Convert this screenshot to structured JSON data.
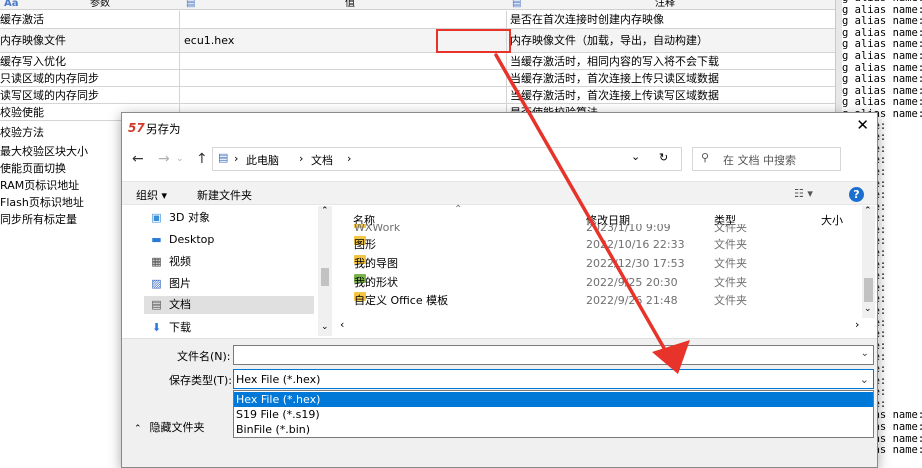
{
  "grid": {
    "headers": [
      "Aa",
      "参数",
      "值",
      "注释"
    ],
    "rows": [
      {
        "param": "缓存激活",
        "value": "",
        "checked": true,
        "note": "是否在首次连接时创建内存映像"
      },
      {
        "param": "内存映像文件",
        "value": "ecu1.hex",
        "checked": false,
        "note": "内存映像文件（加载，导出，自动构建）"
      },
      {
        "param": "缓存写入优化",
        "value": "",
        "checked": true,
        "note": "当缓存激活时，相同内容的写入将不会下载"
      },
      {
        "param": "只读区域的内存同步",
        "value": "",
        "checked": true,
        "note": "当缓存激活时，首次连接上传只读区域数据"
      },
      {
        "param": "读写区域的内存同步",
        "value": "",
        "checked": true,
        "note": "当缓存激活时，首次连接上传读写区域数据"
      },
      {
        "param": "校验使能",
        "value": "",
        "checked": true,
        "note": "是否使能校验算法"
      }
    ],
    "left_labels": [
      "校验方法",
      "最大校验区块大小",
      "使能页面切换",
      "RAM页标识地址",
      "Flash页标识地址",
      "同步所有标定量"
    ]
  },
  "console": {
    "lines": [
      "g alias name:",
      "g alias name:",
      "g alias name:",
      "g alias name:",
      "g alias name:",
      "g alias name:",
      "g alias name:",
      "g alias name:",
      "g alias name:",
      "g alias name:",
      "g alias name:",
      "s name:",
      "s name:",
      "s name:",
      "s name:",
      "s name:",
      "s name:",
      "s name:",
      "s name:",
      "s name:",
      "s name:",
      "s name:",
      "s name:",
      "s name:",
      "s name:",
      "s name:",
      "s name:",
      "s name:",
      "s name:",
      "s name:",
      "s name:",
      "s name:",
      "s name:",
      "s name:",
      "s name:",
      "s name:",
      "g alias name:",
      "g alias name:",
      "g alias name:",
      "g alias name:"
    ]
  },
  "dialog": {
    "icon": "57",
    "title": "另存为",
    "close": "✕",
    "nav": {
      "back": "←",
      "forward": "→",
      "up": "↑"
    },
    "address": {
      "sep": "›",
      "items": [
        "此电脑",
        "文档"
      ],
      "refresh": "↻",
      "dropdown": "⌄"
    },
    "search_placeholder": "在 文档 中搜索",
    "toolbar": {
      "organize": "组织 ▾",
      "new_folder": "新建文件夹",
      "view": "☷ ▾",
      "help": "?"
    },
    "nav_items": [
      {
        "icon": "▣",
        "label": "3D 对象",
        "selected": false
      },
      {
        "icon": "▬",
        "label": "Desktop",
        "selected": false
      },
      {
        "icon": "▦",
        "label": "视频",
        "selected": false
      },
      {
        "icon": "▨",
        "label": "图片",
        "selected": false
      },
      {
        "icon": "▤",
        "label": "文档",
        "selected": true
      },
      {
        "icon": "⬇",
        "label": "下载",
        "selected": false
      }
    ],
    "columns": [
      "名称",
      "修改日期",
      "类型",
      "大小"
    ],
    "files": [
      {
        "name": "WXWork",
        "date": "2023/1/10 9:09",
        "type": "文件夹"
      },
      {
        "name": "图形",
        "date": "2022/10/16 22:33",
        "type": "文件夹"
      },
      {
        "name": "我的导图",
        "date": "2022/12/30 17:53",
        "type": "文件夹"
      },
      {
        "name": "我的形状",
        "date": "2022/9/25 20:30",
        "type": "文件夹"
      },
      {
        "name": "自定义 Office 模板",
        "date": "2022/9/26 21:48",
        "type": "文件夹"
      }
    ],
    "filename_label": "文件名(N):",
    "filename_value": "",
    "filetype_label": "保存类型(T):",
    "filetype_value": "Hex File (*.hex)",
    "filetype_options": [
      "Hex File (*.hex)",
      "S19 File (*.s19)",
      "BinFile (*.bin)"
    ],
    "hide_folders": "隐藏文件夹"
  },
  "colors": {
    "accent": "#0078d7",
    "annotation": "#e8332b"
  }
}
